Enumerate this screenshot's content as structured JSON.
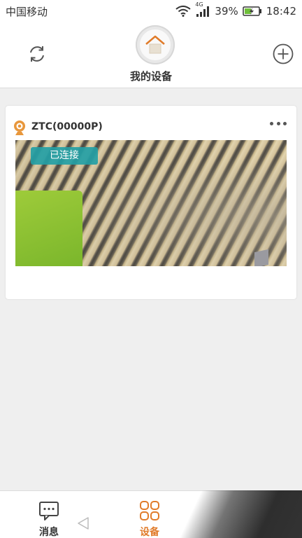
{
  "status_bar": {
    "carrier": "中国移动",
    "network_type": "4G",
    "battery": "39%",
    "time": "18:42"
  },
  "header": {
    "title": "我的设备",
    "icons": {
      "refresh": "refresh-icon",
      "add": "add-icon",
      "home": "home-icon"
    }
  },
  "devices": [
    {
      "name": "ZTC(00000P)",
      "status": "已连接",
      "icon": "camera-icon"
    }
  ],
  "tabbar": {
    "tabs": [
      {
        "label": "消息",
        "icon": "message-icon",
        "active": false
      },
      {
        "label": "设备",
        "icon": "devices-grid-icon",
        "active": true
      }
    ]
  },
  "colors": {
    "accent": "#e07b2a",
    "status_chip": "#24a0a5",
    "background": "#efefef"
  }
}
